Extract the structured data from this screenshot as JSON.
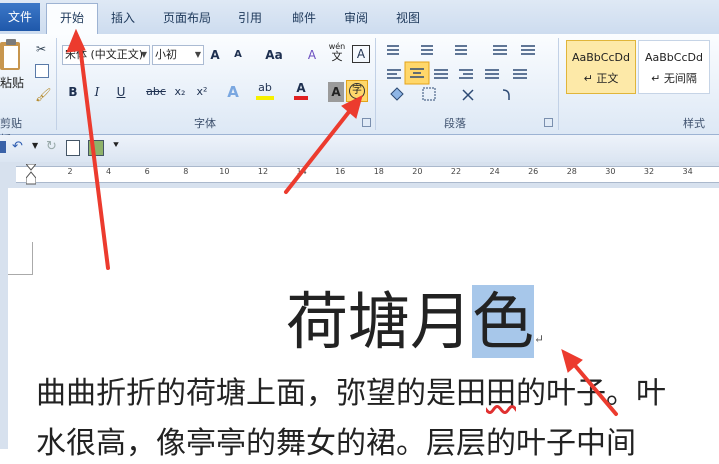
{
  "tabs": {
    "file": "文件",
    "home": "开始",
    "insert": "插入",
    "layout": "页面布局",
    "references": "引用",
    "mailings": "邮件",
    "review": "审阅",
    "view": "视图"
  },
  "clipboard": {
    "paste": "粘贴",
    "group": "剪贴板"
  },
  "font": {
    "name": "宋体 (中文正文)",
    "size": "小初",
    "group": "字体",
    "grow": "A",
    "shrink": "A",
    "case": "Aa",
    "clear": "A",
    "phonetic_top": "wén",
    "phonetic_char": "文",
    "border_char": "A",
    "bold": "B",
    "italic": "I",
    "underline": "U",
    "strike": "abc",
    "sub": "x₂",
    "sup": "x²",
    "effect": "A",
    "highlight": "ab",
    "color": "A",
    "shade": "A",
    "enclose": "字"
  },
  "paragraph": {
    "group": "段落"
  },
  "styles": {
    "group": "样式",
    "items": [
      {
        "preview": "AaBbCcDd",
        "label": "↵ 正文"
      },
      {
        "preview": "AaBbCcDd",
        "label": "↵ 无间隔"
      }
    ]
  },
  "ruler": {
    "numbers": [
      "2",
      "4",
      "6",
      "8",
      "10",
      "12",
      "14",
      "16",
      "18",
      "20",
      "22",
      "24",
      "26",
      "28",
      "30",
      "32",
      "34"
    ]
  },
  "document": {
    "title_main": "荷塘月",
    "title_selected": "色",
    "para_mark": "↵",
    "line1_a": "曲曲折折的荷塘上面，弥望的是田",
    "line1_b": "田",
    "line1_c": "的叶子。叶",
    "line2": "水很高，像亭亭的舞女的裙。层层的叶子中间"
  },
  "colors": {
    "accent": "#1f58aa",
    "arrow": "#ec3b2e",
    "selection": "#a7c7ea"
  }
}
